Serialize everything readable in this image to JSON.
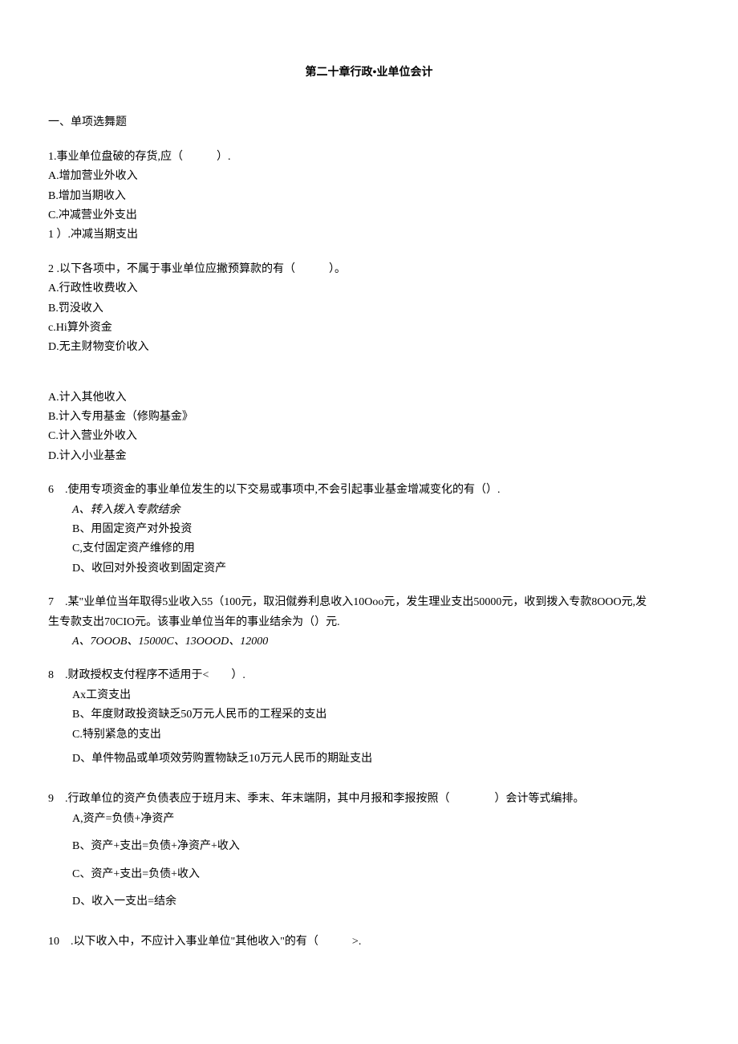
{
  "title": "第二十章行政•业单位会计",
  "sectionHeader": "一、单项选舞题",
  "q1": {
    "text": "1.事业单位盘破的存货,应（　　　）.",
    "a": "A.增加营业外收入",
    "b": "B.增加当期收入",
    "c": "C.冲减营业外支出",
    "d": "1 ）.冲减当期支出"
  },
  "q2": {
    "text": "2 .以下各项中，不属于事业单位应撇预算款的有（　　　）。",
    "a": "A.行政性收费收入",
    "b": "B.罚没收入",
    "c": "c.Hi算外资金",
    "d": "D.无主财物变价收入"
  },
  "q_orphan": {
    "a": "A.计入其他收入",
    "b": "B.计入专用基金（修购基金》",
    "c": "C.计入营业外收入",
    "d": "D.计入小业基金"
  },
  "q6": {
    "text": "6　.使用专项资金的事业单位发生的以下交易或事项中,不会引起事业基金增减变化的有（）.",
    "a": "A、转入拨入专款结余",
    "b": "B、用固定资产对外投资",
    "c": "C,支付固定资产维修的用",
    "d": "D、收回对外投资收到固定资产"
  },
  "q7": {
    "text1": "7　.某\"业单位当年取得5业收入55（100元，取汨僦券利息收入10Ooo元，发生理业支出50000元，收到拨入专款8OOO元,发",
    "text2": "生专款支出70CIO元。该事业单位当年的事业结余为（）元.",
    "opts": "A、7OOOB、15000C、13OOOD、12000"
  },
  "q8": {
    "text": "8　.财政授权支付程序不适用于<　　）.",
    "a": "Ax工资支出",
    "b": "B、年度财政投资缺乏50万元人民币的工程采的支出",
    "c": "C.特别紧急的支出",
    "d": "D、单件物品或单项效劳购置物缺乏10万元人民币的期趾支出"
  },
  "q9": {
    "text": "9　.行政单位的资产负债表应于班月末、季末、年末端阴，其中月报和李报按照（　　　　）会计等式编排。",
    "a": "A,资产=负债+净资产",
    "b": "B、资产+支出=负债+净资产+收入",
    "c": "C、资产+支出=负债+收入",
    "d": "D、收入一支出=结余"
  },
  "q10": {
    "text": "10　.以下收入中，不应计入事业单位\"其他收入\"的有（　　　>."
  }
}
